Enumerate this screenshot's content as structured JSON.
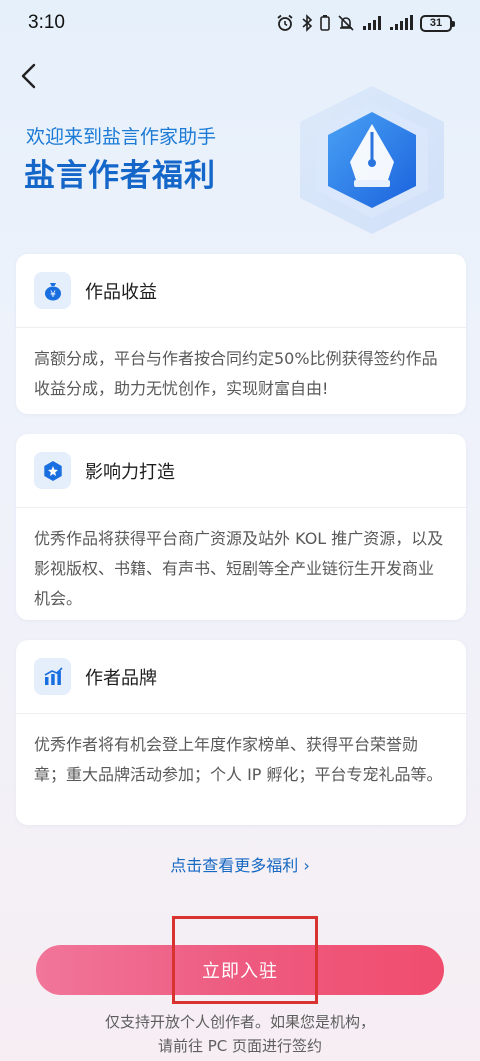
{
  "status_bar": {
    "time": "3:10",
    "battery": "31",
    "icons": [
      "alarm-icon",
      "bluetooth-icon",
      "mute-icon",
      "signal-icon",
      "wifi-icon",
      "battery-icon"
    ]
  },
  "header": {
    "back_icon": "back-arrow-icon",
    "subtitle": "欢迎来到盐言作家助手",
    "title": "盐言作者福利",
    "emblem_icon": "pen-nib-icon"
  },
  "cards": [
    {
      "icon": "money-bag-icon",
      "title": "作品收益",
      "body": "高额分成，平台与作者按合同约定50%比例获得签约作品收益分成，助力无忧创作，实现财富自由!"
    },
    {
      "icon": "influence-star-icon",
      "title": "影响力打造",
      "body": "优秀作品将获得平台商广资源及站外 KOL 推广资源，以及影视版权、书籍、有声书、短剧等全产业链衍生开发商业机会。"
    },
    {
      "icon": "bar-chart-icon",
      "title": "作者品牌",
      "body": "优秀作者将有机会登上年度作家榜单、获得平台荣誉勋章；重大品牌活动参加；个人 IP 孵化；平台专宠礼品等。"
    }
  ],
  "more_link": "点击查看更多福利 ›",
  "join_button": "立即入驻",
  "footnote": {
    "line1": "仅支持开放个人创作者。如果您是机构，",
    "line2": "请前往 PC 页面进行签约"
  },
  "colors": {
    "accent_blue": "#1467c8",
    "button_pink": "#ee5b80",
    "highlight_red": "#d8332f"
  }
}
